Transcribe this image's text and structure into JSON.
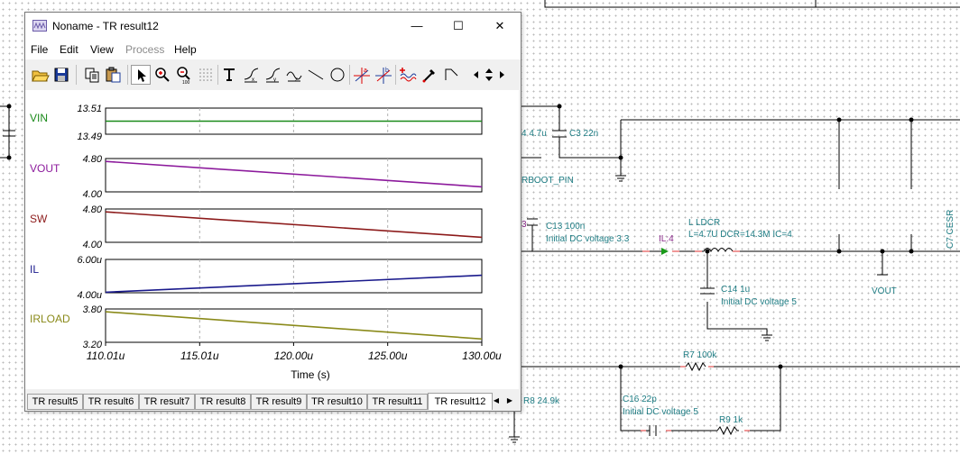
{
  "window": {
    "title": "Noname - TR result12",
    "minimize_glyph": "—",
    "maximize_glyph": "☐",
    "close_glyph": "✕"
  },
  "menu": [
    {
      "label": "File",
      "enabled": true
    },
    {
      "label": "Edit",
      "enabled": true
    },
    {
      "label": "View",
      "enabled": true
    },
    {
      "label": "Process",
      "enabled": false
    },
    {
      "label": "Help",
      "enabled": true
    }
  ],
  "toolbar": [
    "open-folder-icon",
    "save-disk-icon",
    "copy-icon",
    "paste-icon",
    "pointer-arrow-icon",
    "zoom-in-icon",
    "zoom-100-icon",
    "grid-icon",
    "text-tool-icon",
    "curve-tool-1-icon",
    "curve-tool-2-icon",
    "curve-tool-3-icon",
    "line-tool-icon",
    "ellipse-tool-icon",
    "cursor-a-icon",
    "cursor-b-icon",
    "add-trace-icon",
    "color-picker-icon",
    "polyline-tool-icon"
  ],
  "tabs": [
    "TR result5",
    "TR result6",
    "TR result7",
    "TR result8",
    "TR result9",
    "TR result10",
    "TR result11",
    "TR result12"
  ],
  "active_tab": 7,
  "tab_arrows": {
    "left": "◀",
    "right": "▶"
  },
  "chart_data": {
    "type": "line",
    "xlabel": "Time (s)",
    "x_range": [
      110.01,
      130.0
    ],
    "x_ticks": [
      110.01,
      115.01,
      120.0,
      125.0,
      130.0
    ],
    "x_tick_labels": [
      "110.01u",
      "115.01u",
      "120.00u",
      "125.00u",
      "130.00u"
    ],
    "grid": "vertical dashed",
    "panels": [
      {
        "name": "VIN",
        "color": "#1a8a1a",
        "y_range": [
          13.49,
          13.51
        ],
        "y_tick_labels": [
          "13.51",
          "13.49"
        ],
        "x": [
          110.01,
          130.0
        ],
        "y": [
          13.5,
          13.5
        ]
      },
      {
        "name": "VOUT",
        "color": "#8c1a9c",
        "y_range": [
          4.0,
          4.8
        ],
        "y_tick_labels": [
          "4.80",
          "4.00"
        ],
        "x": [
          110.01,
          130.0
        ],
        "y": [
          4.73,
          4.12
        ]
      },
      {
        "name": "SW",
        "color": "#8c1a1a",
        "y_range": [
          4.0,
          4.8
        ],
        "y_tick_labels": [
          "4.80",
          "4.00"
        ],
        "x": [
          110.01,
          130.0
        ],
        "y": [
          4.73,
          4.12
        ]
      },
      {
        "name": "IL",
        "color": "#1a1a8c",
        "y_range": [
          4.0,
          6.0
        ],
        "y_tick_labels": [
          "6.00u",
          "4.00u"
        ],
        "x": [
          110.01,
          130.0
        ],
        "y": [
          4.03,
          5.05
        ]
      },
      {
        "name": "IRLOAD",
        "color": "#8a8a1a",
        "y_range": [
          3.2,
          3.8
        ],
        "y_tick_labels": [
          "3.80",
          "3.20"
        ],
        "x": [
          110.01,
          130.0
        ],
        "y": [
          3.75,
          3.26
        ]
      }
    ]
  },
  "schematic": {
    "labels": [
      "4 4.7u",
      "C3 22n",
      "RBOOT_PIN",
      "3",
      "C13 100n",
      "Initial DC voltage 3.3",
      "IL:4",
      "L LDCR",
      "L=4.7U DCR=14.3M IC=4",
      "C7 CESR",
      "C14 1u",
      "Initial DC voltage 5",
      "VOUT",
      "R7 100k",
      "R8 24.9k",
      "C16 22p",
      "Initial DC voltage 5",
      "R9 1k"
    ]
  }
}
